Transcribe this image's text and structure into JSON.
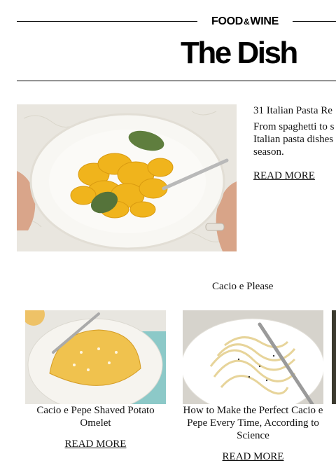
{
  "header": {
    "brand_left": "FOOD",
    "brand_amp": "&",
    "brand_right": "WINE",
    "masthead": "The Dish"
  },
  "feature": {
    "image_desc": "tortellini-with-sage",
    "title": "31 Italian Pasta Re",
    "desc_line1": "From spaghetti to s",
    "desc_line2": "Italian pasta dishes",
    "desc_line3": "season.",
    "link_label": "READ MORE"
  },
  "section": {
    "title": "Cacio e Please",
    "cards": [
      {
        "title": "Cacio e Pepe Shaved Potato Omelet",
        "link_label": "READ MORE"
      },
      {
        "title": "How to Make the Perfect Cacio e Pepe Every Time, According to Science",
        "link_label": "READ MORE"
      }
    ]
  },
  "colors": {
    "text": "#111111",
    "rule": "#000000",
    "background": "#ffffff"
  }
}
